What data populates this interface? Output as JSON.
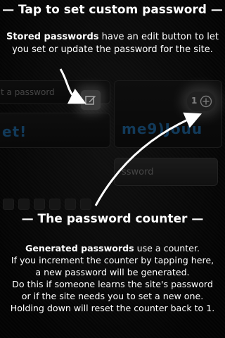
{
  "background_app": {
    "site_placeholder": "t a password",
    "password_left": "et!",
    "password_right": "me9)Jouu",
    "counter_value": "1",
    "generate_button_label": "ssword"
  },
  "tip_edit": {
    "title": "— Tap to set custom password —",
    "bold_lead": "Stored passwords",
    "text": " have an edit button to let you set or update the password for the site."
  },
  "tip_counter": {
    "title": "— The password counter —",
    "bold_lead": "Generated passwords",
    "text": " use a counter.",
    "lines": [
      "If you increment the counter by tapping here,",
      "a new password will be generated.",
      "Do this if someone learns the site's password",
      "or if the site needs you to set a new one.",
      "Holding down will reset the counter back to 1."
    ]
  },
  "icons": [
    "edit-icon",
    "plus-circle-icon"
  ],
  "colors": {
    "accent_text": "#1c5a8a",
    "overlay_text": "#ffffff"
  }
}
